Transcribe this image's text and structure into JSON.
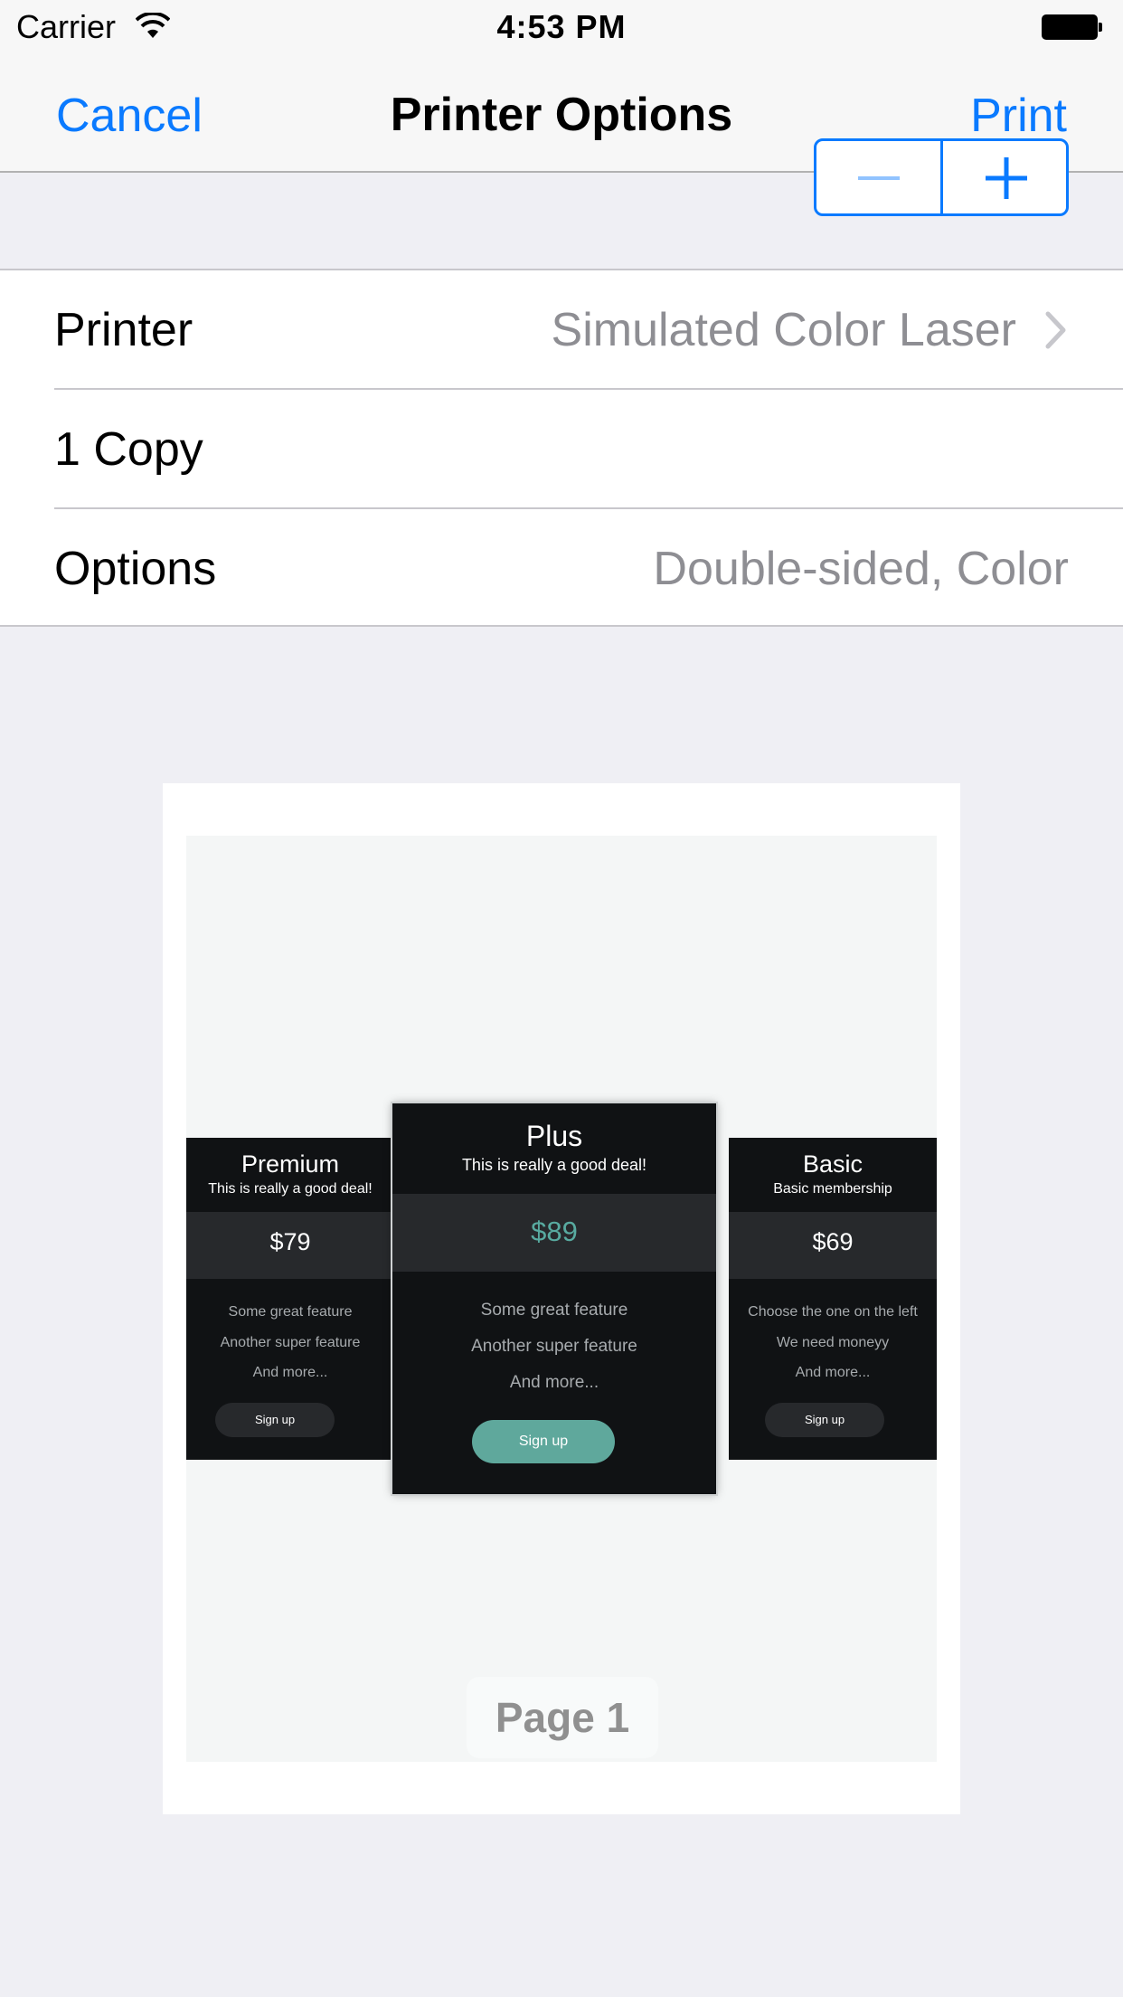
{
  "status_bar": {
    "carrier": "Carrier",
    "time": "4:53 PM"
  },
  "nav": {
    "cancel_label": "Cancel",
    "title": "Printer Options",
    "print_label": "Print"
  },
  "settings": {
    "printer": {
      "label": "Printer",
      "value": "Simulated Color Laser"
    },
    "copies": {
      "label": "1 Copy",
      "count": 1
    },
    "options": {
      "label": "Options",
      "value": "Double-sided, Color"
    }
  },
  "preview": {
    "page_label": "Page 1",
    "plans": [
      {
        "name": "Premium",
        "subtitle": "This is really a good deal!",
        "price": "$79",
        "features": [
          "Some great feature",
          "Another super feature",
          "And more..."
        ],
        "button": "Sign up"
      },
      {
        "name": "Plus",
        "subtitle": "This is really a good deal!",
        "price": "$89",
        "features": [
          "Some great feature",
          "Another super feature",
          "And more..."
        ],
        "button": "Sign up"
      },
      {
        "name": "Basic",
        "subtitle": "Basic membership",
        "price": "$69",
        "features": [
          "Choose the one on the left",
          "We need moneyy",
          "And more..."
        ],
        "button": "Sign up"
      }
    ]
  },
  "colors": {
    "accent": "#0a7aff",
    "card_background": "#101214",
    "highlight_price": "#58aaa0",
    "highlight_button": "#5fa89c"
  },
  "icons": [
    "wifi-icon",
    "battery-icon",
    "chevron-right-icon",
    "minus-icon",
    "plus-icon"
  ]
}
